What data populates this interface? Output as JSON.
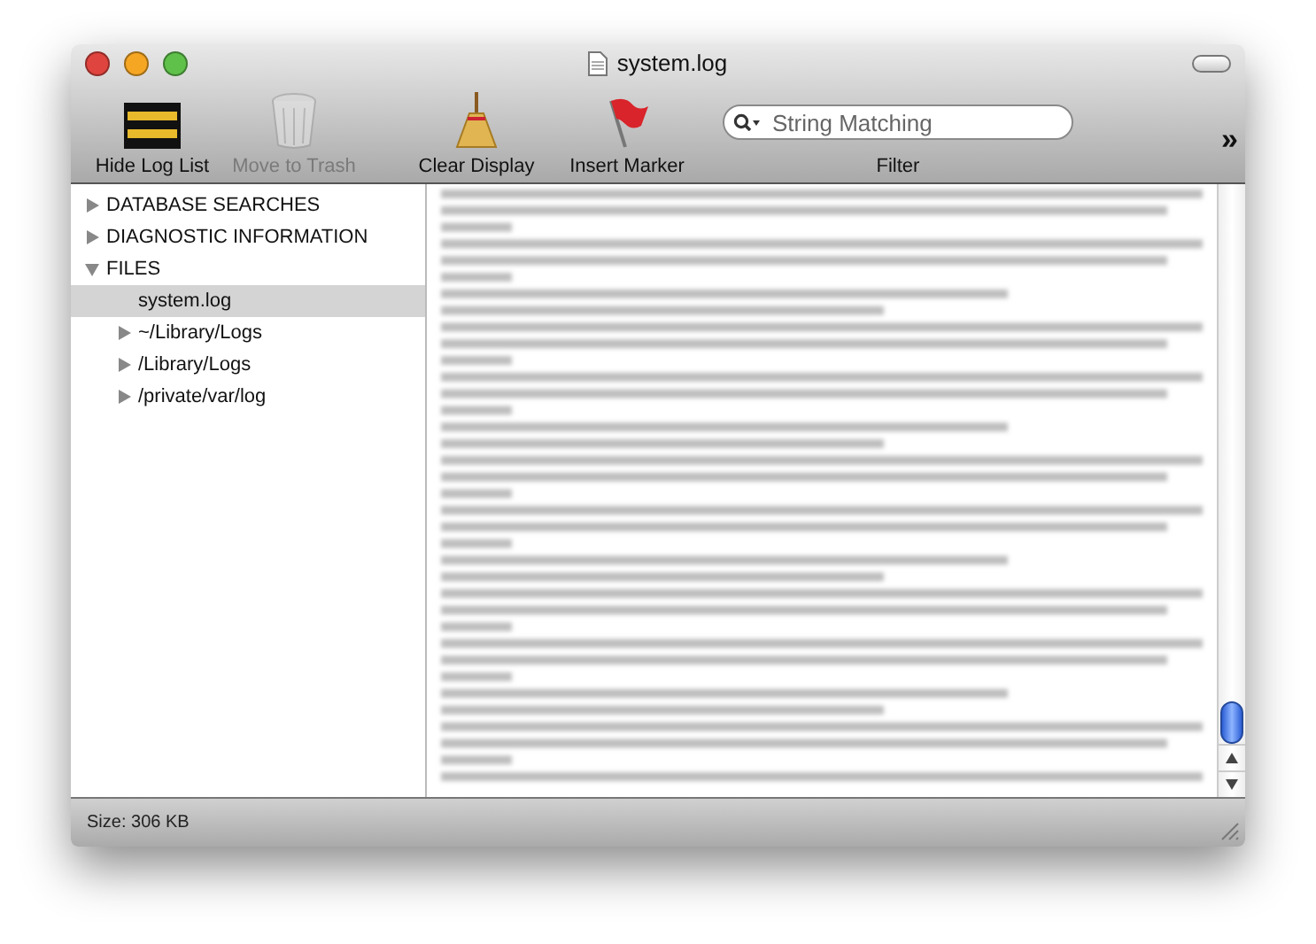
{
  "window": {
    "title": "system.log"
  },
  "toolbar": {
    "items": [
      {
        "kind": "console",
        "label": "Hide Log List",
        "disabled": false
      },
      {
        "kind": "trash",
        "label": "Move to Trash",
        "disabled": true
      },
      {
        "kind": "broom",
        "label": "Clear Display",
        "disabled": false
      },
      {
        "kind": "flag",
        "label": "Insert Marker",
        "disabled": false
      },
      {
        "kind": "search",
        "label": "Filter",
        "placeholder": "String Matching",
        "disabled": false
      }
    ],
    "overflow": "»"
  },
  "sidebar": {
    "items": [
      {
        "label": "DATABASE SEARCHES",
        "expanded": false,
        "selected": false
      },
      {
        "label": "DIAGNOSTIC INFORMATION",
        "expanded": false,
        "selected": false
      },
      {
        "label": "FILES",
        "expanded": true,
        "selected": false,
        "children": [
          {
            "label": "system.log",
            "leaf": true,
            "selected": true
          },
          {
            "label": "~/Library/Logs",
            "expanded": false,
            "selected": false
          },
          {
            "label": "/Library/Logs",
            "expanded": false,
            "selected": false
          },
          {
            "label": "/private/var/log",
            "expanded": false,
            "selected": false
          }
        ]
      }
    ]
  },
  "status_bar": {
    "text": "Size: 306 KB"
  }
}
